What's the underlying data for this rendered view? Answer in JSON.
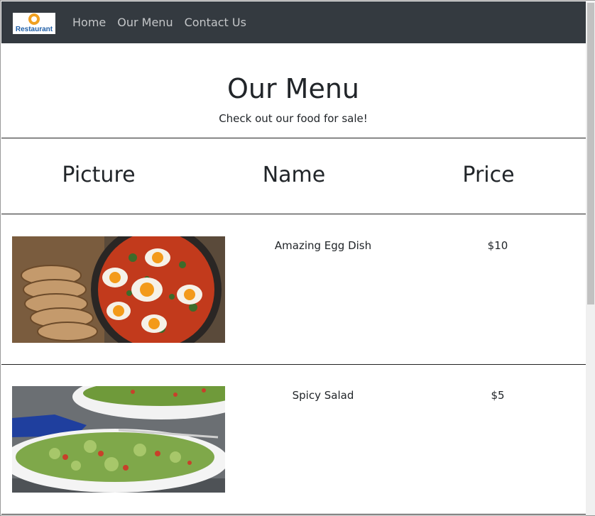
{
  "brand": {
    "logo_text": "Restaurant"
  },
  "nav": {
    "items": [
      {
        "label": "Home"
      },
      {
        "label": "Our Menu"
      },
      {
        "label": "Contact Us"
      }
    ]
  },
  "page": {
    "title": "Our Menu",
    "subtitle": "Check out our food for sale!"
  },
  "table": {
    "headers": [
      "Picture",
      "Name",
      "Price"
    ],
    "rows": [
      {
        "picture": "egg-dish-photo",
        "name": "Amazing Egg Dish",
        "price": "$10"
      },
      {
        "picture": "salad-photo",
        "name": "Spicy Salad",
        "price": "$5"
      }
    ]
  },
  "colors": {
    "navbar": "#343a40",
    "nav_link": "#c4c6c8",
    "text": "#212529"
  }
}
